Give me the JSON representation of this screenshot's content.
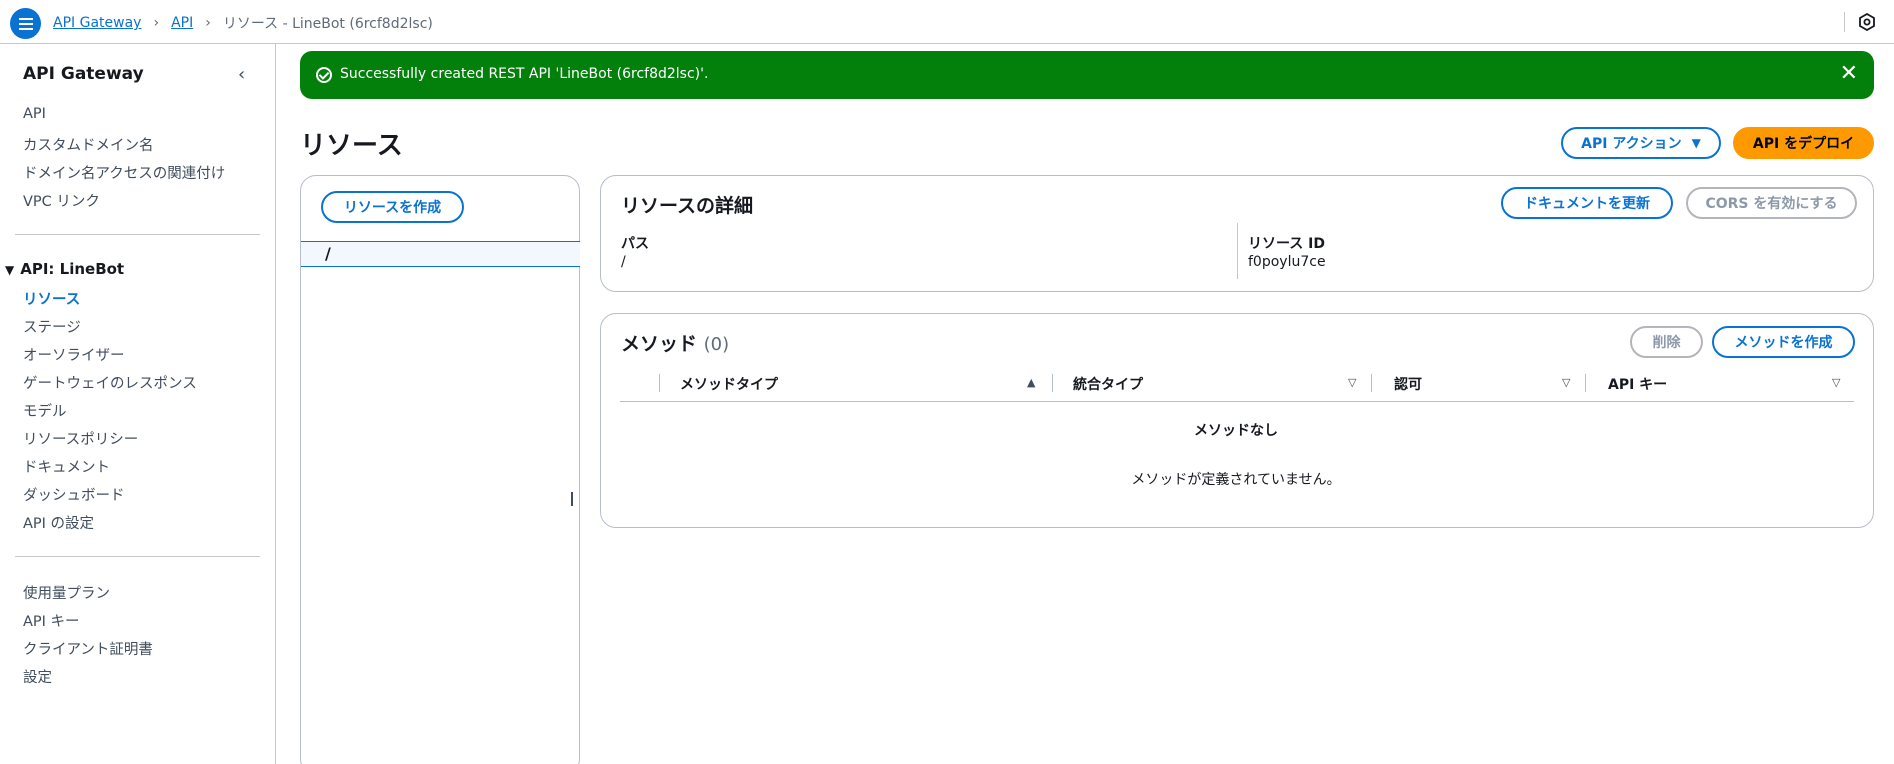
{
  "breadcrumb": {
    "items": [
      "API Gateway",
      "API"
    ],
    "current": "リソース - LineBot (6rcf8d2lsc)"
  },
  "sidebar": {
    "title": "API Gateway",
    "top_items": [
      "API",
      "カスタムドメイン名",
      "ドメイン名アクセスの関連付け",
      "VPC リンク"
    ],
    "section_title": "API: LineBot",
    "section_items": [
      "リソース",
      "ステージ",
      "オーソライザー",
      "ゲートウェイのレスポンス",
      "モデル",
      "リソースポリシー",
      "ドキュメント",
      "ダッシュボード",
      "API の設定"
    ],
    "active_item": "リソース",
    "bottom_items": [
      "使用量プラン",
      "API キー",
      "クライアント証明書",
      "設定"
    ]
  },
  "flash": {
    "message": "Successfully created REST API 'LineBot (6rcf8d2lsc)'."
  },
  "page": {
    "title": "リソース",
    "actions_button": "API アクション",
    "deploy_button": "API をデプロイ"
  },
  "tree": {
    "create_button": "リソースを作成",
    "root_path": "/"
  },
  "details": {
    "title": "リソースの詳細",
    "update_docs_button": "ドキュメントを更新",
    "cors_button": "CORS を有効にする",
    "path_label": "パス",
    "path_value": "/",
    "id_label": "リソース ID",
    "id_value": "f0poylu7ce"
  },
  "methods": {
    "title": "メソッド",
    "count": "(0)",
    "delete_button": "削除",
    "create_button": "メソッドを作成",
    "columns": [
      "メソッドタイプ",
      "統合タイプ",
      "認可",
      "API キー"
    ],
    "empty_title": "メソッドなし",
    "empty_desc": "メソッドが定義されていません。"
  },
  "colors": {
    "accent": "#0972d3",
    "success": "#037f0c",
    "primary_button": "#ff9900"
  }
}
